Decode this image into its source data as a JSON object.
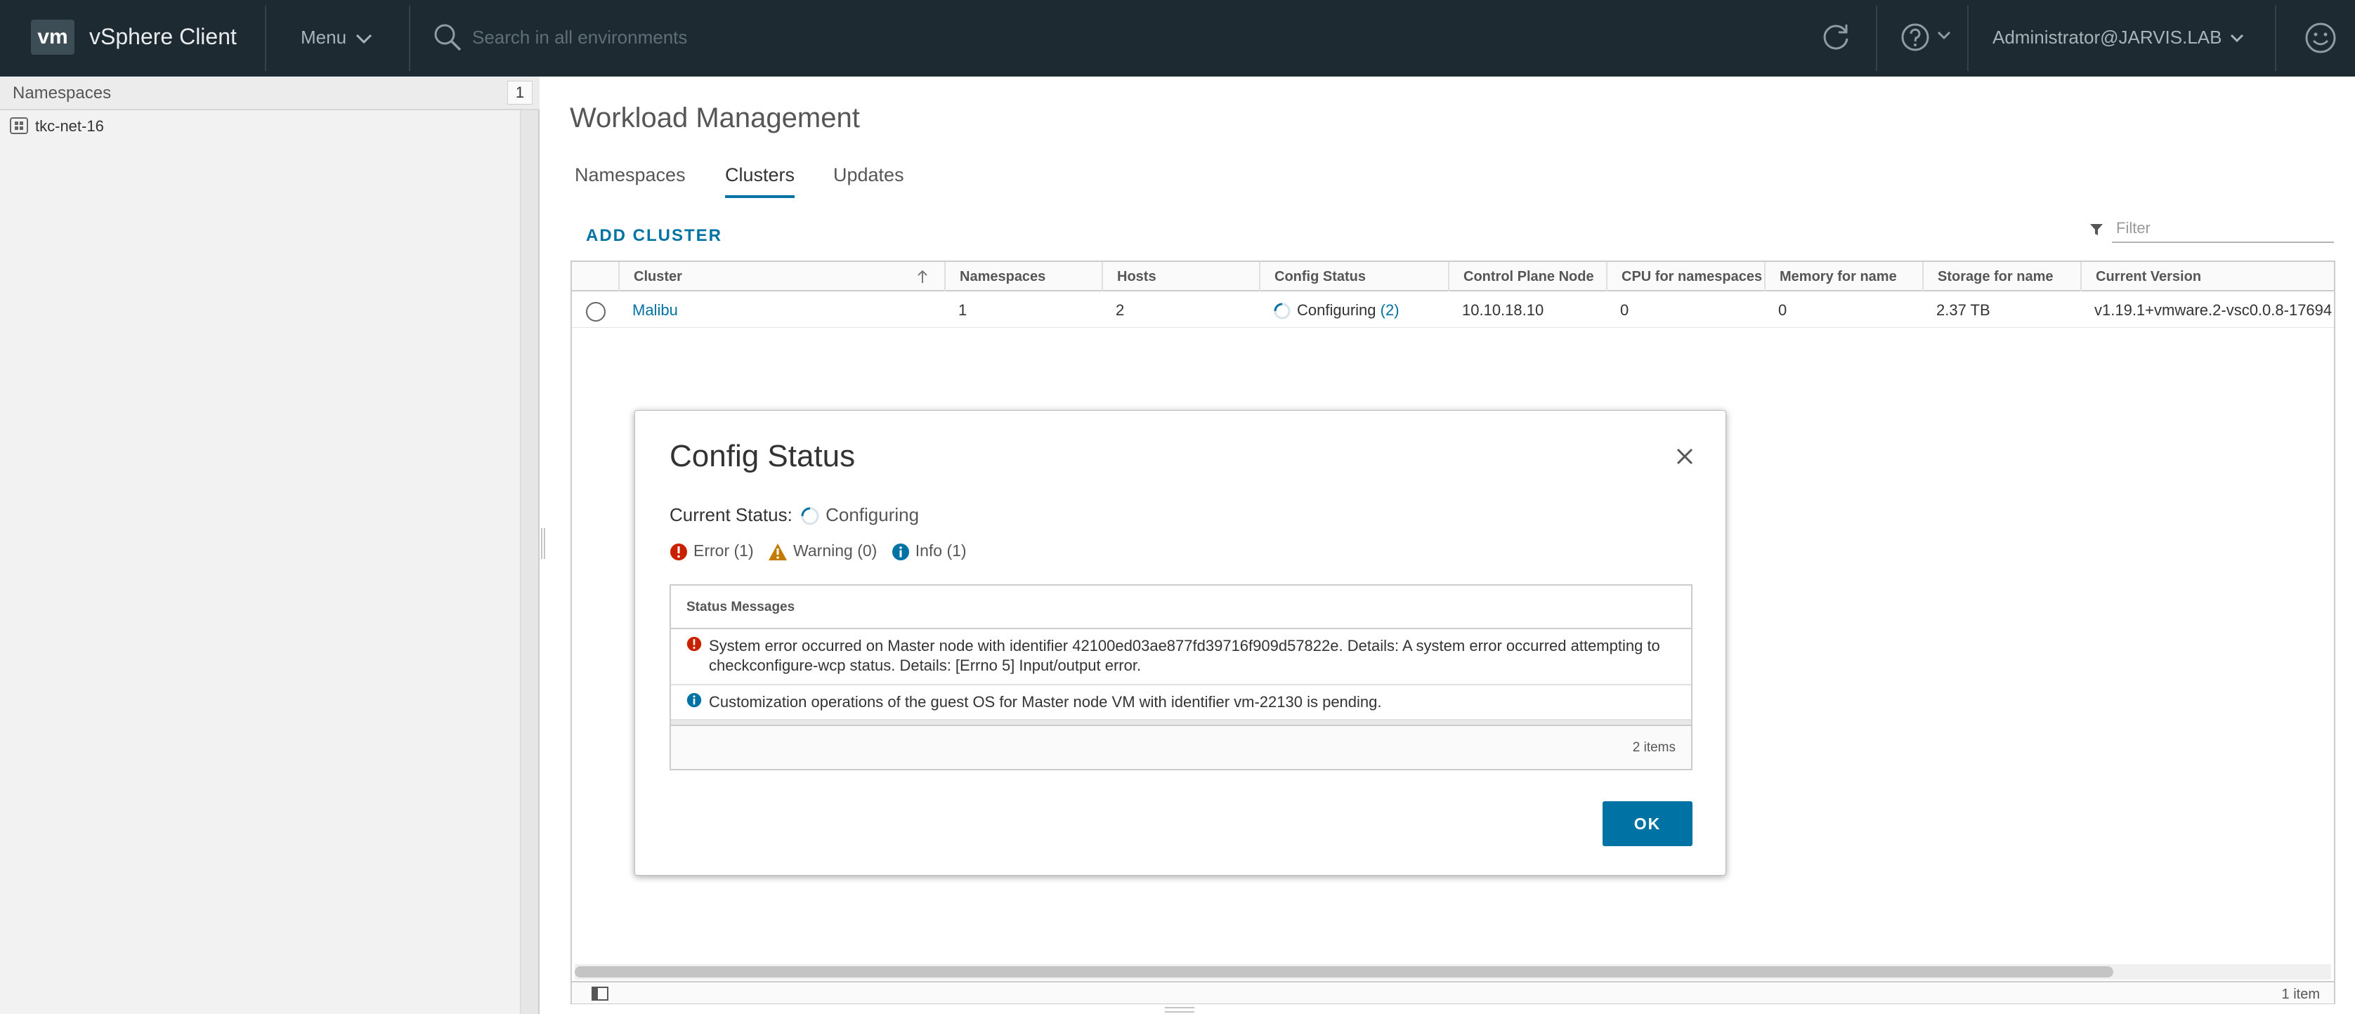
{
  "header": {
    "logo_text": "vm",
    "app_title": "vSphere Client",
    "menu_label": "Menu",
    "search_placeholder": "Search in all environments",
    "user_label": "Administrator@JARVIS.LAB",
    "bg_color": "#1d2a31",
    "icons": [
      "chevron-down-icon",
      "search-icon",
      "refresh-icon",
      "help-icon",
      "smile-icon"
    ]
  },
  "left_pane": {
    "header_label": "Namespaces",
    "count": "1",
    "items": [
      {
        "label": "tkc-net-16",
        "icon": "namespace-icon"
      }
    ]
  },
  "main": {
    "title": "Workload Management",
    "tabs": [
      {
        "label": "Namespaces",
        "active": false
      },
      {
        "label": "Clusters",
        "active": true
      },
      {
        "label": "Updates",
        "active": false
      }
    ],
    "add_cluster_label": "ADD CLUSTER",
    "filter_placeholder": "Filter",
    "accent_color": "#0072a3"
  },
  "grid": {
    "columns": [
      {
        "label": ""
      },
      {
        "label": "Cluster"
      },
      {
        "label": "Namespaces"
      },
      {
        "label": "Hosts"
      },
      {
        "label": "Config Status"
      },
      {
        "label": "Control Plane Node"
      },
      {
        "label": "CPU for namespaces"
      },
      {
        "label": "Memory for name"
      },
      {
        "label": "Storage for name"
      },
      {
        "label": "Current Version"
      }
    ],
    "rows": [
      {
        "cluster": "Malibu",
        "namespaces": "1",
        "hosts": "2",
        "config_status": "Configuring",
        "config_status_count": "(2)",
        "control_plane": "10.10.18.10",
        "cpu": "0",
        "memory": "0",
        "storage": "2.37 TB",
        "version": "v1.19.1+vmware.2-vsc0.0.8-17694"
      }
    ],
    "footer_count": "1 item"
  },
  "modal": {
    "title": "Config Status",
    "current_status_label": "Current Status:",
    "current_status_value": "Configuring",
    "counts": {
      "error": "Error (1)",
      "warning": "Warning (0)",
      "info": "Info (1)"
    },
    "messages_header": "Status Messages",
    "messages": [
      {
        "type": "error",
        "text": "System error occurred on Master node with identifier 42100ed03ae877fd39716f909d57822e. Details: A system error occurred attempting to checkconfigure-wcp status. Details: [Errno 5] Input/output error."
      },
      {
        "type": "info",
        "text": "Customization operations of the guest OS for Master node VM with identifier vm-22130 is pending."
      }
    ],
    "messages_footer_count": "2 items",
    "ok_label": "OK",
    "colors": {
      "error": "#c92100",
      "warning": "#c27b00",
      "info": "#0072a3"
    }
  }
}
